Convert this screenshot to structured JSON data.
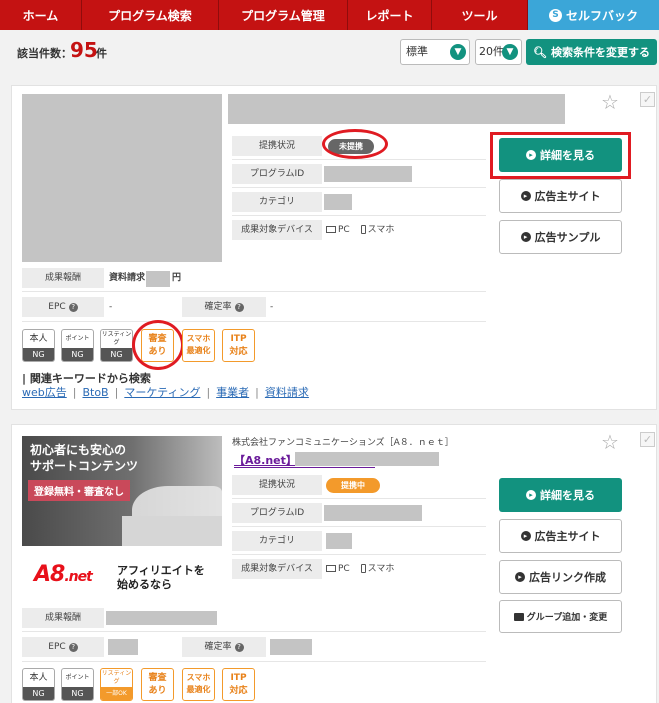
{
  "nav": {
    "items": [
      "ホーム",
      "プログラム検索",
      "プログラム管理",
      "レポート",
      "ツール"
    ],
    "self_back": "セルフバック"
  },
  "results": {
    "count_label": "該当件数：",
    "count": "95",
    "count_unit": "件",
    "sort_value": "標準",
    "per_page_value": "20件",
    "search_button": "検索条件を変更する"
  },
  "labels": {
    "status": "提携状況",
    "program_id": "プログラムID",
    "category": "カテゴリ",
    "device": "成果対象デバイス",
    "pc": "PC",
    "smartphone": "スマホ",
    "reward": "成果報酬",
    "epc": "EPC",
    "confirm_rate": "確定率",
    "detail_button": "詳細を見る",
    "advertiser_site": "広告主サイト",
    "ad_sample": "広告サンプル",
    "ad_link": "広告リンク作成",
    "group_add": "グループ追加・変更"
  },
  "card1": {
    "status_badge": "未提携",
    "reward_text": "資料請求",
    "reward_unit": "円",
    "epc_value": "-",
    "confirm_value": "-",
    "badges": {
      "self": [
        "本人",
        "NG"
      ],
      "point": [
        "ポイント",
        "NG"
      ],
      "listing": [
        "リスティング",
        "NG"
      ],
      "review": [
        "審査",
        "あり"
      ],
      "smartphone_opt": [
        "スマホ",
        "最適化"
      ],
      "itp": [
        "ITP",
        "対応"
      ]
    },
    "keywords_title": "| 関連キーワードから検索",
    "keywords": [
      "web広告",
      "BtoB",
      "マーケティング",
      "事業者",
      "資料請求"
    ]
  },
  "card2": {
    "company": "株式会社ファンコミュニケーションズ［A８．ｎｅｔ］",
    "program_name": "【A8.net】",
    "status_badge": "提携中",
    "banner": {
      "headline_1": "初心者にも安心の",
      "headline_2": "サポートコンテンツ",
      "tag": "登録無料・審査なし",
      "logo": "A8",
      "logo_suffix": ".net",
      "caption_1": "アフィリエイトを",
      "caption_2": "始めるなら"
    },
    "badges": {
      "self": [
        "本人",
        "NG"
      ],
      "point": [
        "ポイント",
        "NG"
      ],
      "listing": [
        "リスティング",
        "一部OK"
      ],
      "review": [
        "審査",
        "あり"
      ],
      "smartphone_opt": [
        "スマホ",
        "最適化"
      ],
      "itp": [
        "ITP",
        "対応"
      ]
    }
  },
  "colors": {
    "nav_red": "#c41212",
    "self_back_blue": "#3ba6d8",
    "primary_green": "#12927f",
    "status_orange": "#f39a2b",
    "highlight_red": "#e01b22"
  }
}
